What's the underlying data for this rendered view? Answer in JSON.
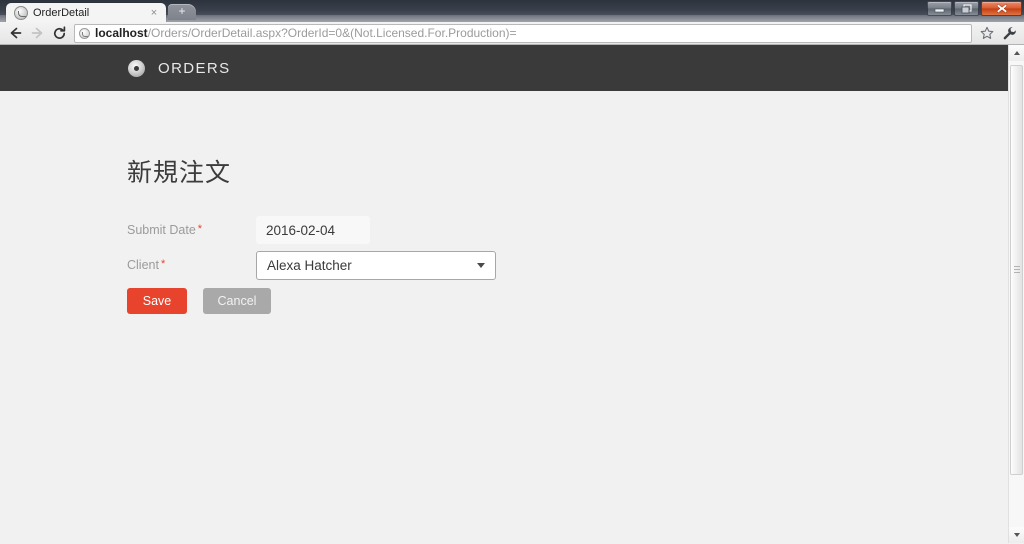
{
  "browser": {
    "tab": {
      "title": "OrderDetail",
      "favicon_name": "globe-icon",
      "close_label": "×"
    },
    "newtab_label": "+",
    "nav": {
      "back_label": "back-arrow",
      "forward_label": "forward-arrow",
      "reload_label": "reload-arrow"
    },
    "omnibox": {
      "host": "localhost",
      "path": "/Orders/OrderDetail.aspx?OrderId=0&(Not.Licensed.For.Production)=",
      "full_url": "localhost/Orders/OrderDetail.aspx?OrderId=0&(Not.Licensed.For.Production)=",
      "bookmark_icon": "star-icon",
      "menu_icon": "wrench-icon"
    },
    "window_controls": {
      "minimize": "minimize-icon",
      "maximize": "maximize-icon",
      "close": "close-icon"
    }
  },
  "site": {
    "header": {
      "logo_icon": "disc-icon",
      "brand": "ORDERS",
      "background": "#3a3a3a"
    },
    "page_title": "新規注文",
    "form": {
      "required_marker": "*",
      "fields": [
        {
          "label": "Submit Date",
          "required": true,
          "type": "text",
          "value": "2016-02-04",
          "placeholder": ""
        },
        {
          "label": "Client",
          "required": true,
          "type": "select",
          "value": "Alexa Hatcher",
          "placeholder": ""
        }
      ],
      "buttons": [
        {
          "label": "Save",
          "color": "#e8432c"
        },
        {
          "label": "Cancel",
          "color": "#a9a9a9"
        }
      ]
    },
    "colors": {
      "page_background": "#f1f1f1",
      "accent": "#e8432c",
      "required_asterisk": "#e8432c",
      "label_text": "#9b9b9b"
    }
  }
}
